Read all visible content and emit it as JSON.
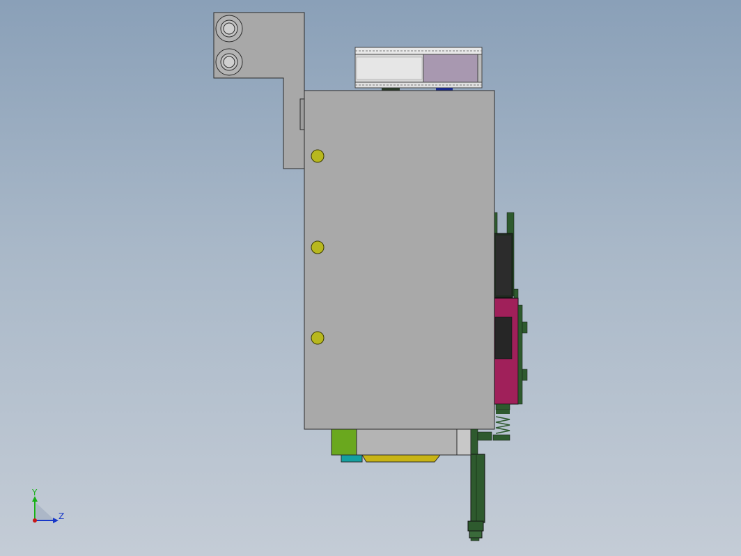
{
  "viewport": {
    "background_top": "#8aa0b8",
    "background_bottom": "#c4ccd6"
  },
  "colors": {
    "body_gray": "#a9a9a9",
    "bracket_gray": "#a8a8a8",
    "screw_yellow": "#b8b81e",
    "green_block": "#6aa81e",
    "cyan_tab": "#14a0a0",
    "yellow_base": "#c8b414",
    "dark_green": "#2e5a2e",
    "magenta": "#a0205a",
    "pulley_light": "#d8d8d8",
    "pulley_purple": "#a898b0",
    "axis_y": "#18b018",
    "axis_z": "#1838c8",
    "axis_origin": "#c81818"
  },
  "triad": {
    "y_label": "Y",
    "z_label": "Z"
  }
}
